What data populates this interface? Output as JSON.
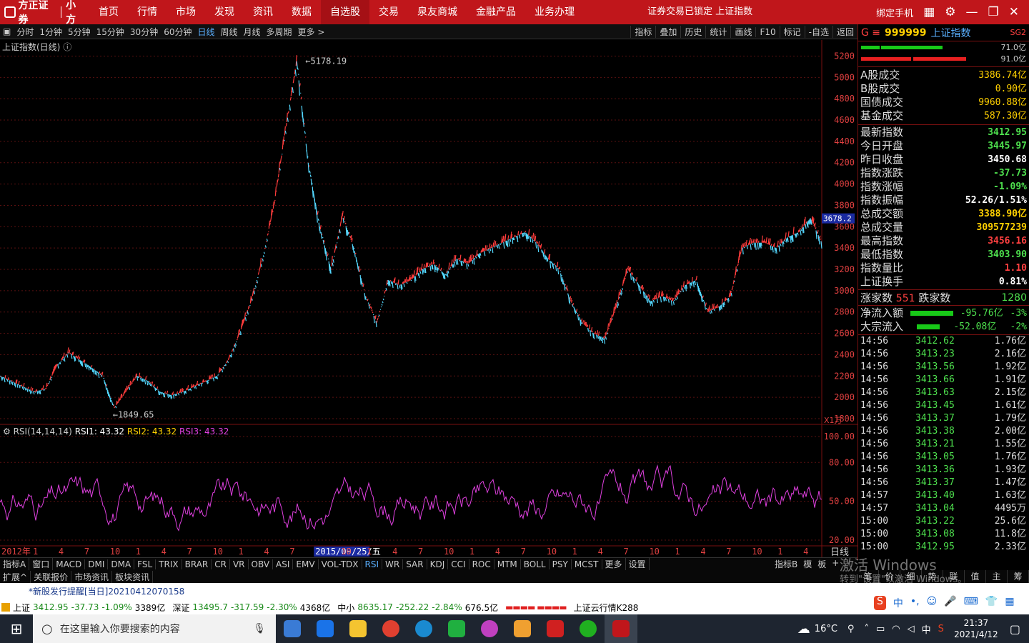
{
  "brand": {
    "name": "方正证券",
    "app": "小方"
  },
  "nav": [
    "首页",
    "行情",
    "市场",
    "发现",
    "资讯",
    "数据",
    "自选股",
    "交易",
    "泉友商城",
    "金融产品",
    "业务办理"
  ],
  "active_nav": "自选股",
  "top_status": "证券交易已锁定     上证指数",
  "bind_phone": "绑定手机",
  "periods": [
    "分时",
    "1分钟",
    "5分钟",
    "15分钟",
    "30分钟",
    "60分钟",
    "日线",
    "周线",
    "月线",
    "多周期",
    "更多 >"
  ],
  "tools": [
    "指标",
    "叠加",
    "历史",
    "统计",
    "画线",
    "F10",
    "标记",
    "-自选",
    "返回"
  ],
  "chart_title": "上证指数(日线)",
  "rsi_label": "RSI(14,14,14)",
  "rsi_values": {
    "rsi1": "RSI1: 43.32",
    "rsi2": "RSI2: 43.32",
    "rsi3": "RSI3: 43.32"
  },
  "chart_data": {
    "type": "line",
    "title": "上证指数(日线)",
    "ylim": [
      1800,
      5250
    ],
    "yticks": [
      1800,
      2000,
      2200,
      2400,
      2600,
      2800,
      3000,
      3200,
      3400,
      3600,
      3800,
      4000,
      4200,
      4400,
      4600,
      4800,
      5000,
      5200
    ],
    "high_label": "5178.19",
    "low_label": "1849.65",
    "cursor_price": "3678.2",
    "unit": "X1万",
    "series": [
      {
        "values": [
          2200,
          2150,
          2100,
          2050,
          2080,
          2300,
          2420,
          2350,
          2280,
          2200,
          1900,
          2050,
          2200,
          2150,
          2050,
          2020,
          2050,
          2100,
          2150,
          2200,
          2350,
          2600,
          2900,
          3300,
          3800,
          4500,
          5150,
          4200,
          3600,
          3200,
          3700,
          3400,
          2950,
          2700,
          3100,
          3050,
          3100,
          3200,
          3250,
          3150,
          3300,
          3250,
          3350,
          3400,
          3450,
          3500,
          3550,
          3450,
          3300,
          3200,
          2900,
          2700,
          2600,
          2550,
          2850,
          3200,
          3050,
          2900,
          2950,
          2900,
          3050,
          3100,
          2800,
          2850,
          2950,
          3400,
          3450,
          3450,
          3400,
          3500,
          3550,
          3680,
          3450
        ]
      }
    ],
    "rsi": {
      "ylim": [
        20,
        100
      ],
      "yticks": [
        "100.00",
        "80.00",
        "50.00",
        "20.00"
      ]
    },
    "xaxis": [
      "2012年",
      "1",
      "4",
      "7",
      "10",
      "1",
      "4",
      "7",
      "10",
      "1",
      "4",
      "7",
      "2015/09/25/五",
      "10",
      "1",
      "4",
      "7",
      "10",
      "1",
      "4",
      "7",
      "10",
      "1",
      "4",
      "7",
      "10",
      "1",
      "4",
      "7",
      "10",
      "1",
      "4"
    ],
    "period_label": "日线"
  },
  "panel": {
    "code": "999999",
    "name": "上证指数",
    "sg": "SG2",
    "bars": [
      "71.0亿",
      "91.0亿"
    ],
    "vol": [
      {
        "l": "A股成交",
        "v": "3386.74亿"
      },
      {
        "l": "B股成交",
        "v": "0.90亿"
      },
      {
        "l": "国债成交",
        "v": "9960.88亿"
      },
      {
        "l": "基金成交",
        "v": "587.30亿"
      }
    ],
    "quote": [
      {
        "l": "最新指数",
        "v": "3412.95",
        "c": "#4ee04e"
      },
      {
        "l": "今日开盘",
        "v": "3445.97",
        "c": "#4ee04e"
      },
      {
        "l": "昨日收盘",
        "v": "3450.68",
        "c": "#fff"
      },
      {
        "l": "指数涨跌",
        "v": "-37.73",
        "c": "#4ee04e"
      },
      {
        "l": "指数涨幅",
        "v": "-1.09%",
        "c": "#4ee04e"
      },
      {
        "l": "指数振幅",
        "v": "52.26/1.51%",
        "c": "#fff"
      },
      {
        "l": "总成交额",
        "v": "3388.90亿",
        "c": "#ffd000"
      },
      {
        "l": "总成交量",
        "v": "309577239",
        "c": "#ffd000"
      },
      {
        "l": "最高指数",
        "v": "3456.16",
        "c": "#ff4040"
      },
      {
        "l": "最低指数",
        "v": "3403.90",
        "c": "#4ee04e"
      },
      {
        "l": "指数量比",
        "v": "1.10",
        "c": "#ff4040"
      },
      {
        "l": "上证换手",
        "v": "0.81%",
        "c": "#fff"
      }
    ],
    "up_label": "涨家数",
    "up": "551",
    "down_label": "跌家数",
    "down": "1280",
    "flow": [
      {
        "l": "净流入额",
        "v": "-95.76亿",
        "p": "-3%"
      },
      {
        "l": "大宗流入",
        "v": "-52.08亿",
        "p": "-2%"
      }
    ],
    "ticks": [
      [
        "14:56",
        "3412.62",
        "1.76亿"
      ],
      [
        "14:56",
        "3413.23",
        "2.16亿"
      ],
      [
        "14:56",
        "3413.56",
        "1.92亿"
      ],
      [
        "14:56",
        "3413.66",
        "1.91亿"
      ],
      [
        "14:56",
        "3413.63",
        "2.15亿"
      ],
      [
        "14:56",
        "3413.45",
        "1.61亿"
      ],
      [
        "14:56",
        "3413.37",
        "1.79亿"
      ],
      [
        "14:56",
        "3413.38",
        "2.00亿"
      ],
      [
        "14:56",
        "3413.21",
        "1.55亿"
      ],
      [
        "14:56",
        "3413.05",
        "1.76亿"
      ],
      [
        "14:56",
        "3413.36",
        "1.93亿"
      ],
      [
        "14:56",
        "3413.37",
        "1.47亿"
      ],
      [
        "14:57",
        "3413.40",
        "1.63亿"
      ],
      [
        "14:57",
        "3413.04",
        "4495万"
      ],
      [
        "15:00",
        "3413.22",
        "25.6亿"
      ],
      [
        "15:00",
        "3413.08",
        "11.8亿"
      ],
      [
        "15:00",
        "3412.95",
        "2.33亿"
      ]
    ]
  },
  "indicator_tabs": [
    "指标A",
    "窗口",
    "MACD",
    "DMI",
    "DMA",
    "FSL",
    "TRIX",
    "BRAR",
    "CR",
    "VR",
    "OBV",
    "ASI",
    "EMV",
    "VOL-TDX",
    "RSI",
    "WR",
    "SAR",
    "KDJ",
    "CCI",
    "ROC",
    "MTM",
    "BOLL",
    "PSY",
    "MCST",
    "更多",
    "设置"
  ],
  "indicator_active": "RSI",
  "right_tabs": [
    "指标B",
    "模",
    "板",
    "+"
  ],
  "bottom_tabs": [
    "扩展^",
    "关联报价",
    "市场资讯",
    "板块资讯"
  ],
  "panel_tabs": [
    "笔",
    "价",
    "细",
    "势",
    "联",
    "值",
    "主",
    "筹"
  ],
  "watermark": [
    "激活 Windows",
    "转到\"设置\"以激活 Windows。"
  ],
  "notice": "*新股发行提醒[当日]20210412070158",
  "status": {
    "sh": "上证",
    "sh_v": "3412.95",
    "sh_c": "-37.73",
    "sh_p": "-1.09%",
    "sh_a": "3389亿",
    "sz": "深证",
    "sz_v": "13495.7",
    "sz_c": "-317.59",
    "sz_p": "-2.30%",
    "sz_a": "4368亿",
    "zx": "中小",
    "zx_v": "8635.17",
    "zx_c": "-252.22",
    "zx_p": "-2.84%",
    "zx_a": "676.5亿",
    "cloud": "上证云行情K288"
  },
  "taskbar": {
    "search": "在这里输入你要搜索的内容",
    "temp": "16°C",
    "ime": "中",
    "time": "21:37",
    "date": "2021/4/12"
  }
}
